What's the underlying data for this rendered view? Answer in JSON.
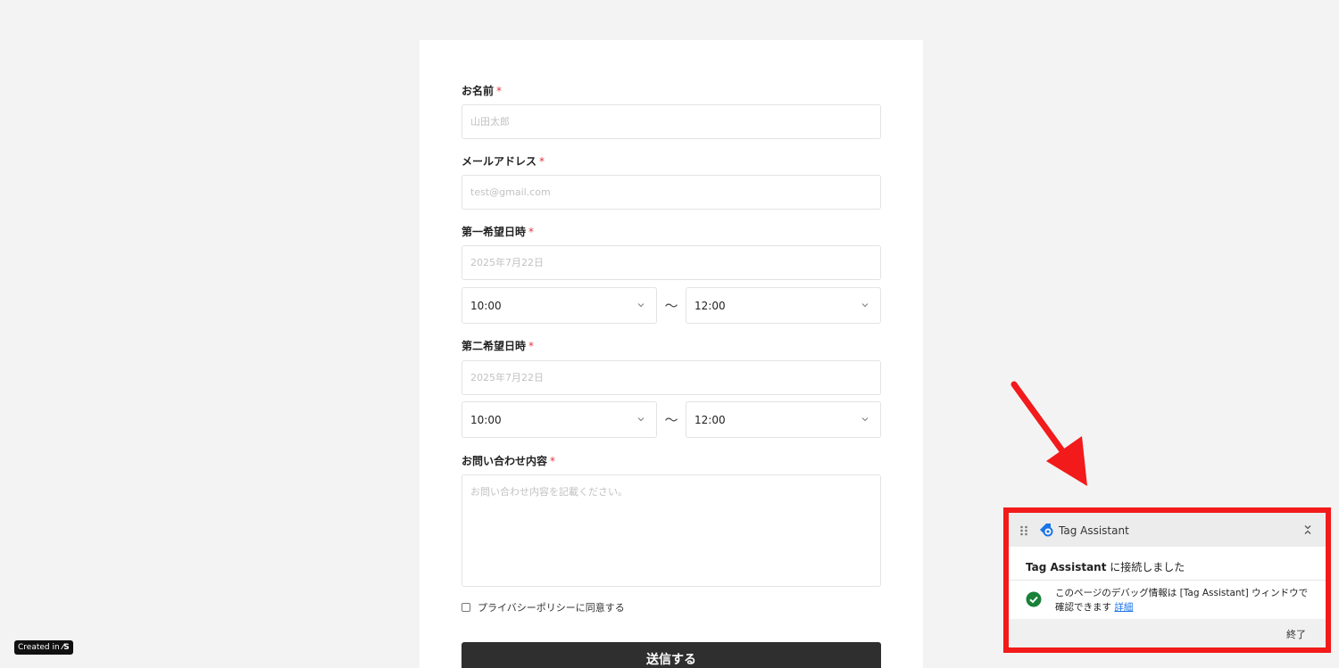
{
  "form": {
    "required_mark": "*",
    "name_label": "お名前",
    "name_placeholder": "山田太郎",
    "email_label": "メールアドレス",
    "email_placeholder": "test@gmail.com",
    "first_choice_label": "第一希望日時",
    "first_choice_date_placeholder": "2025年7月22日",
    "first_choice_start": "10:00",
    "first_choice_end": "12:00",
    "second_choice_label": "第二希望日時",
    "second_choice_date_placeholder": "2025年7月22日",
    "second_choice_start": "10:00",
    "second_choice_end": "12:00",
    "range_separator": "〜",
    "inquiry_label": "お問い合わせ内容",
    "inquiry_placeholder": "お問い合わせ内容を記載ください。",
    "privacy_label": "プライバシーポリシーに同意する",
    "submit_label": "送信する"
  },
  "badge": {
    "prefix": "Created in",
    "mark": "⁄S"
  },
  "tag_assistant": {
    "title": "Tag Assistant",
    "connected_bold": "Tag Assistant",
    "connected_rest": " に接続しました",
    "message": "このページのデバッグ情報は [Tag Assistant] ウィンドウで確認できます ",
    "details_link": "詳細",
    "end_label": "終了",
    "icon": "tag-assistant-logo",
    "highlight_color": "#f21a1a"
  }
}
